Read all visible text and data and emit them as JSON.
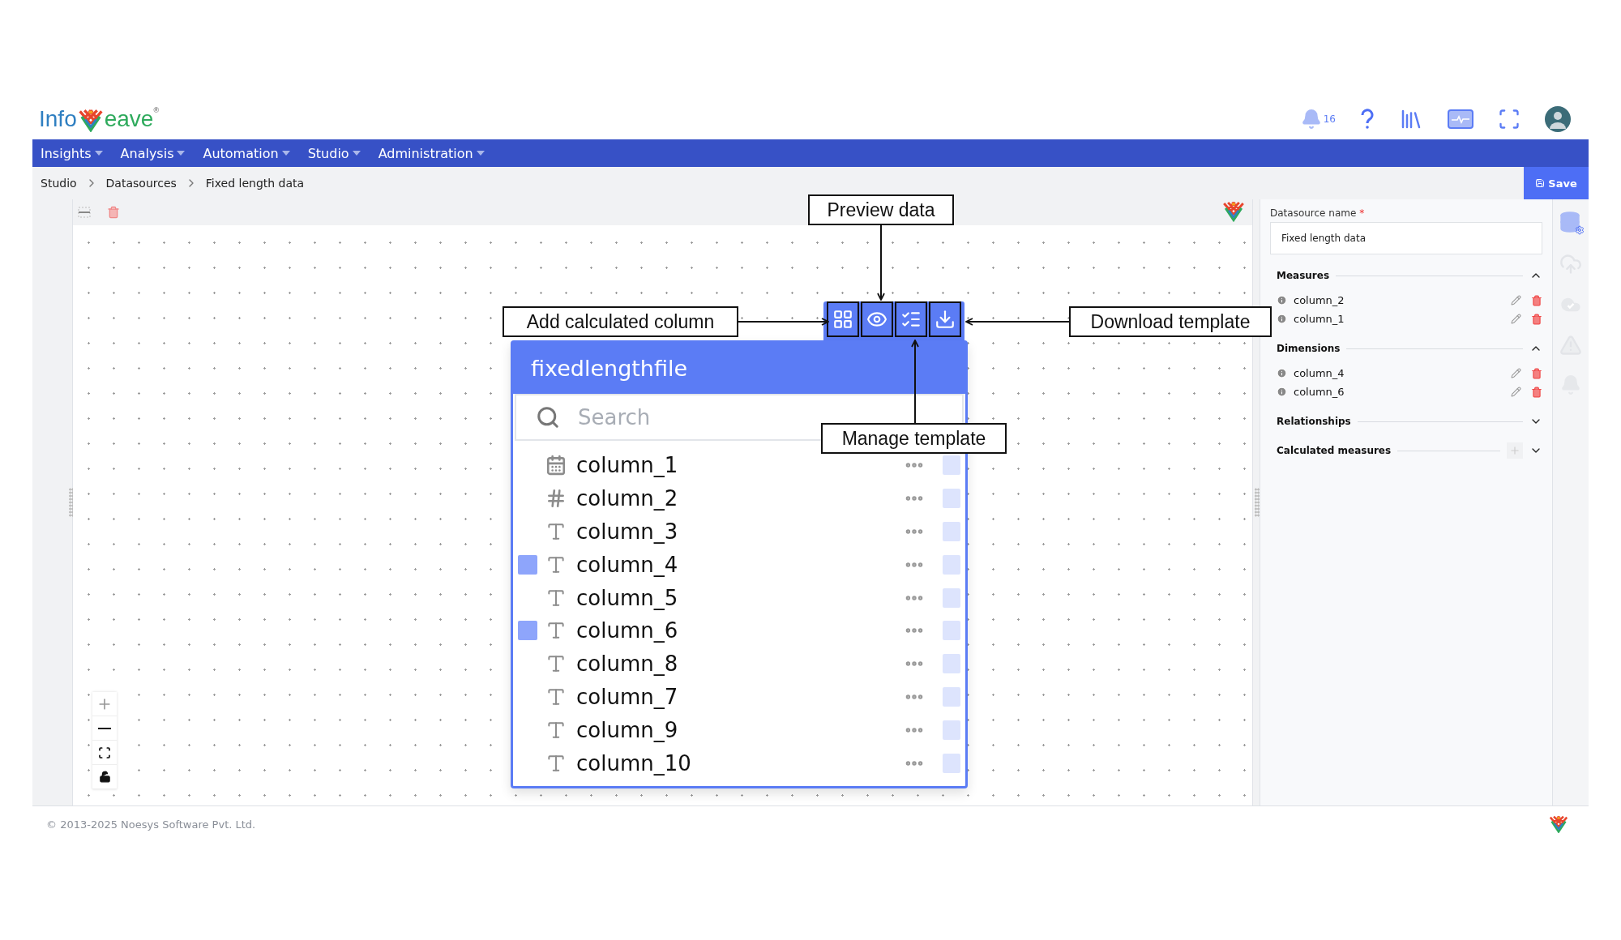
{
  "logo": {
    "text_left": "Info",
    "text_right": "eave",
    "trademark": "®"
  },
  "notifications": {
    "count": "16"
  },
  "nav": [
    {
      "label": "Insights"
    },
    {
      "label": "Analysis"
    },
    {
      "label": "Automation"
    },
    {
      "label": "Studio"
    },
    {
      "label": "Administration"
    }
  ],
  "breadcrumb": [
    "Studio",
    "Datasources",
    "Fixed length data"
  ],
  "save_button": "Save",
  "table": {
    "title": "fixedlengthfile",
    "search_placeholder": "Search",
    "columns": [
      {
        "name": "column_1",
        "kind": "date",
        "selected": false
      },
      {
        "name": "column_2",
        "kind": "number",
        "selected": false
      },
      {
        "name": "column_3",
        "kind": "text",
        "selected": false
      },
      {
        "name": "column_4",
        "kind": "text",
        "selected": true
      },
      {
        "name": "column_5",
        "kind": "text",
        "selected": false
      },
      {
        "name": "column_6",
        "kind": "text",
        "selected": true
      },
      {
        "name": "column_8",
        "kind": "text",
        "selected": false
      },
      {
        "name": "column_7",
        "kind": "text",
        "selected": false
      },
      {
        "name": "column_9",
        "kind": "text",
        "selected": false
      },
      {
        "name": "column_10",
        "kind": "text",
        "selected": false
      }
    ]
  },
  "annotations": [
    {
      "kind": "top",
      "label": "Preview data"
    },
    {
      "kind": "left",
      "label": "Add calculated column"
    },
    {
      "kind": "right",
      "label": "Download template"
    },
    {
      "kind": "bottom",
      "label": "Manage template"
    }
  ],
  "panel": {
    "name_label": "Datasource name",
    "required_mark": "*",
    "name_value": "Fixed length data",
    "sections": [
      {
        "title": "Measures",
        "expanded": true,
        "items": [
          "column_2",
          "column_1"
        ]
      },
      {
        "title": "Dimensions",
        "expanded": true,
        "items": [
          "column_4",
          "column_6"
        ]
      },
      {
        "title": "Relationships",
        "expanded": false
      },
      {
        "title": "Calculated measures",
        "expanded": false,
        "addable": true
      }
    ]
  },
  "footer": {
    "copyright": "© 2013-2025 Noesys Software Pvt. Ltd."
  }
}
